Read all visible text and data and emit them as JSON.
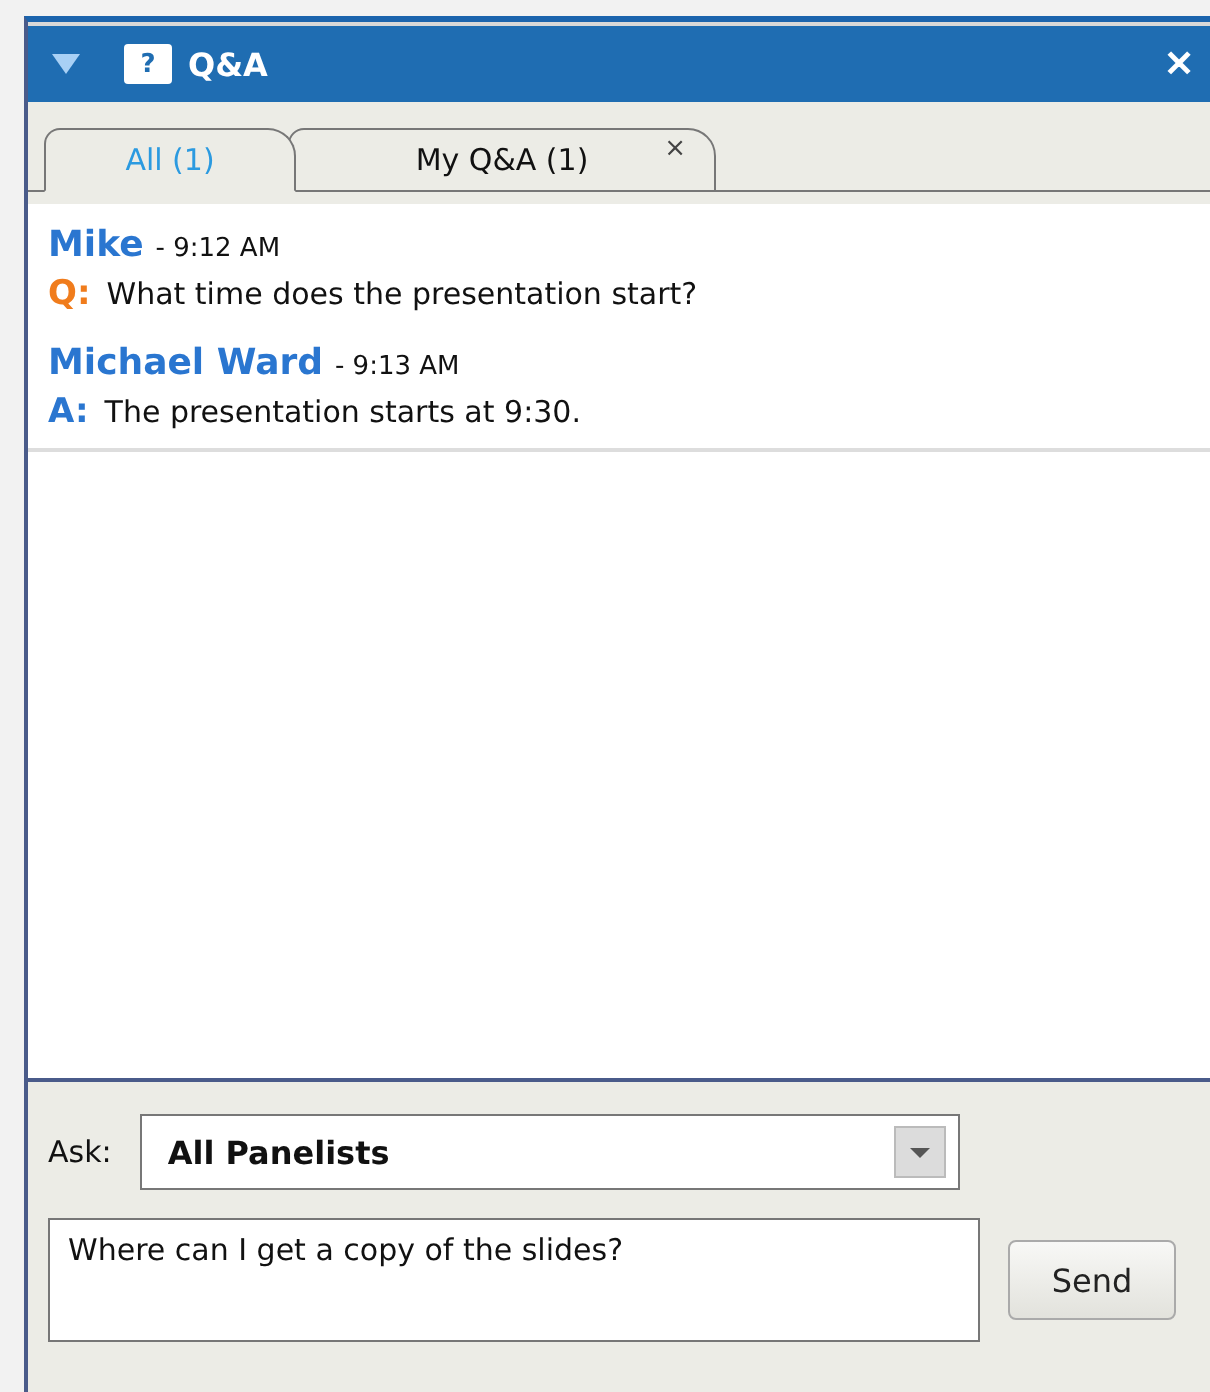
{
  "window": {
    "title": "Q&A",
    "title_icon": "?",
    "close": "✕"
  },
  "tabs": [
    {
      "label": "All (1)",
      "selected": true
    },
    {
      "label": "My Q&A (1)",
      "selected": false,
      "close": "×"
    }
  ],
  "messages": [
    {
      "author": "Mike",
      "time": "- 9:12 AM",
      "kind": "question",
      "prefix": "Q:",
      "text": "What time does the presentation start?"
    },
    {
      "author": "Michael Ward",
      "time": "- 9:13 AM",
      "kind": "answer",
      "prefix": "A:",
      "text": "The presentation starts at 9:30."
    }
  ],
  "ask": {
    "label": "Ask:",
    "value": "All Panelists"
  },
  "composer": {
    "value": "Where can I get a copy of the slides?",
    "send": "Send"
  }
}
